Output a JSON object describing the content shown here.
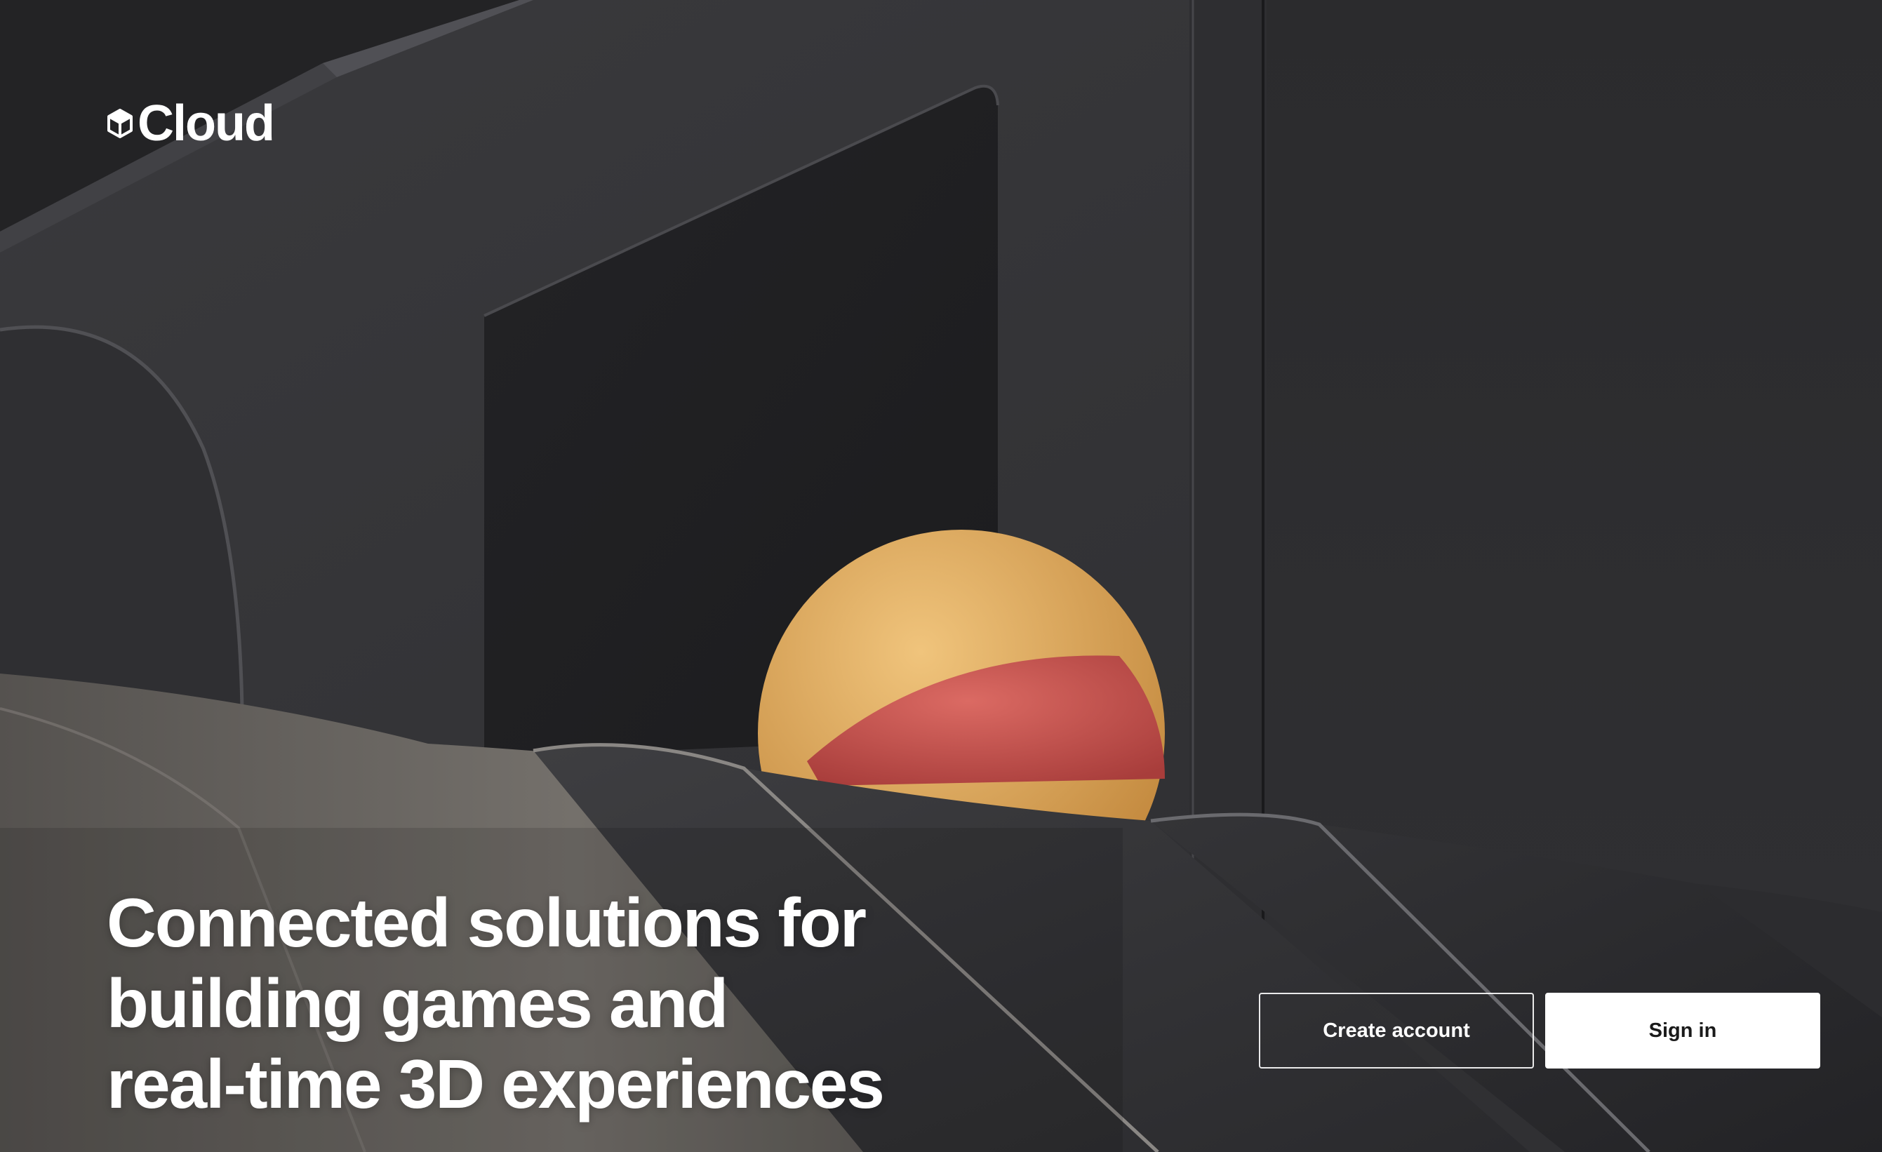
{
  "brand": {
    "logo_icon": "unity-cube-icon",
    "name": "Cloud"
  },
  "hero": {
    "headline_lines": [
      "Connected solutions for",
      "building games and",
      "real-time 3D experiences"
    ]
  },
  "actions": {
    "create_account_label": "Create account",
    "sign_in_label": "Sign in"
  },
  "colors": {
    "background": "#2a2a2c",
    "ball_yellow": "#d9a456",
    "ball_red": "#c44e4b",
    "button_primary_bg": "#ffffff",
    "text": "#ffffff"
  }
}
